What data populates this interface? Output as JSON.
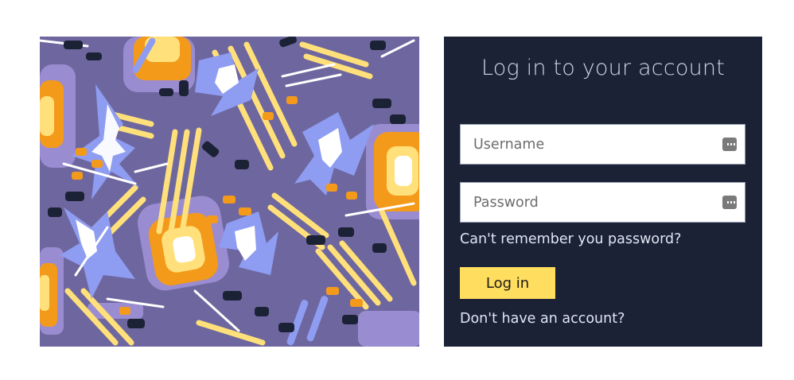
{
  "image": {
    "icon": "abstract-pattern-image",
    "colors": {
      "background": "#6e679f",
      "lavender": "#9a8cd0",
      "periwinkle": "#8e9cf1",
      "yellow": "#ffe07a",
      "orange": "#f39a1b",
      "navy": "#1c2236",
      "white": "#ffffff"
    }
  },
  "login": {
    "title": "Log in to your account",
    "username_placeholder": "Username",
    "password_placeholder": "Password",
    "field_icon": "password-manager-icon",
    "forgot_link": "Can't remember you password?",
    "login_button": "Log in",
    "signup_link": "Don't have an account?",
    "colors": {
      "panel_background": "#1b2236",
      "button_background": "#ffdd5e",
      "text": "#dfe5f3"
    }
  }
}
